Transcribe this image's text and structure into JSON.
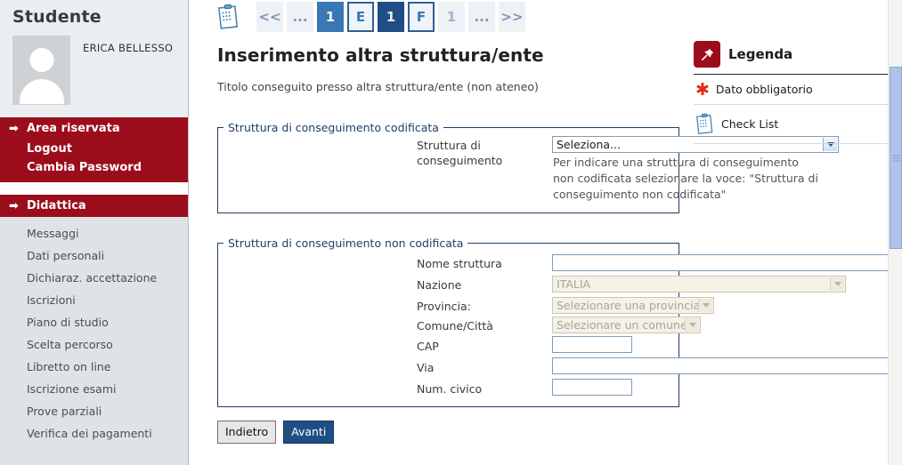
{
  "sidebar": {
    "title": "Studente",
    "student_name": "ERICA BELLESSO",
    "avatar_icon": "user-avatar-placeholder",
    "reserved_area": {
      "header": "Area riservata",
      "items": [
        "Logout",
        "Cambia Password"
      ]
    },
    "didattica": {
      "header": "Didattica",
      "items": [
        "Messaggi",
        "Dati personali",
        "Dichiaraz. accettazione",
        "Iscrizioni",
        "Piano di studio",
        "Scelta percorso",
        "Libretto on line",
        "Iscrizione esami",
        "Prove parziali",
        "Verifica dei pagamenti"
      ]
    }
  },
  "stepbar": {
    "clipboard_icon": "clipboard-icon",
    "steps": [
      {
        "label": "<<",
        "state": "navdim"
      },
      {
        "label": "...",
        "state": "navdim"
      },
      {
        "label": "1",
        "state": "mid"
      },
      {
        "label": "E",
        "state": "outline"
      },
      {
        "label": "1",
        "state": "current"
      },
      {
        "label": "F",
        "state": "outline"
      },
      {
        "label": "1",
        "state": "dim"
      },
      {
        "label": "...",
        "state": "navdim"
      },
      {
        "label": ">>",
        "state": "navdim"
      }
    ]
  },
  "main": {
    "title": "Inserimento altra struttura/ente",
    "subtitle": "Titolo conseguito presso altra struttura/ente (non ateneo)",
    "fieldset_coded": {
      "legend": "Struttura di conseguimento codificata",
      "field_label": "Struttura di conseguimento",
      "select_value": "Seleziona...",
      "hint": "Per indicare una struttura di conseguimento non codificata selezionare la voce: \"Struttura di conseguimento non codificata\""
    },
    "fieldset_uncoded": {
      "legend": "Struttura di conseguimento non codificata",
      "fields": [
        {
          "label": "Nome struttura",
          "type": "text",
          "value": "",
          "disabled": false
        },
        {
          "label": "Nazione",
          "type": "select",
          "value": "ITALIA",
          "disabled": true
        },
        {
          "label": "Provincia:",
          "type": "select",
          "value": "Selezionare una provincia",
          "disabled": true
        },
        {
          "label": "Comune/Città",
          "type": "select",
          "value": "Selezionare un comune",
          "disabled": true
        },
        {
          "label": "CAP",
          "type": "text",
          "value": "",
          "disabled": false
        },
        {
          "label": "Via",
          "type": "text",
          "value": "",
          "disabled": false
        },
        {
          "label": "Num. civico",
          "type": "text",
          "value": "",
          "disabled": false
        }
      ]
    },
    "buttons": {
      "back": "Indietro",
      "next": "Avanti"
    }
  },
  "legend_panel": {
    "title": "Legenda",
    "pin_icon": "pin-icon",
    "rows": [
      {
        "icon": "asterisk-icon",
        "label": "Dato obbligatorio"
      },
      {
        "icon": "clipboard-icon",
        "label": "Check List"
      }
    ]
  },
  "colors": {
    "brand_red": "#9c0d1c",
    "accent_blue": "#1f4e86",
    "step_mid_blue": "#3a77b5",
    "fieldset_border": "#1f3f66",
    "disabled_field_bg": "#f4f1e6",
    "sidebar_bg": "#dfe3e6",
    "required_asterisk": "#e02b16"
  },
  "scrollbar": {
    "orientation": "vertical",
    "thumb_color": "#aec3e8"
  }
}
